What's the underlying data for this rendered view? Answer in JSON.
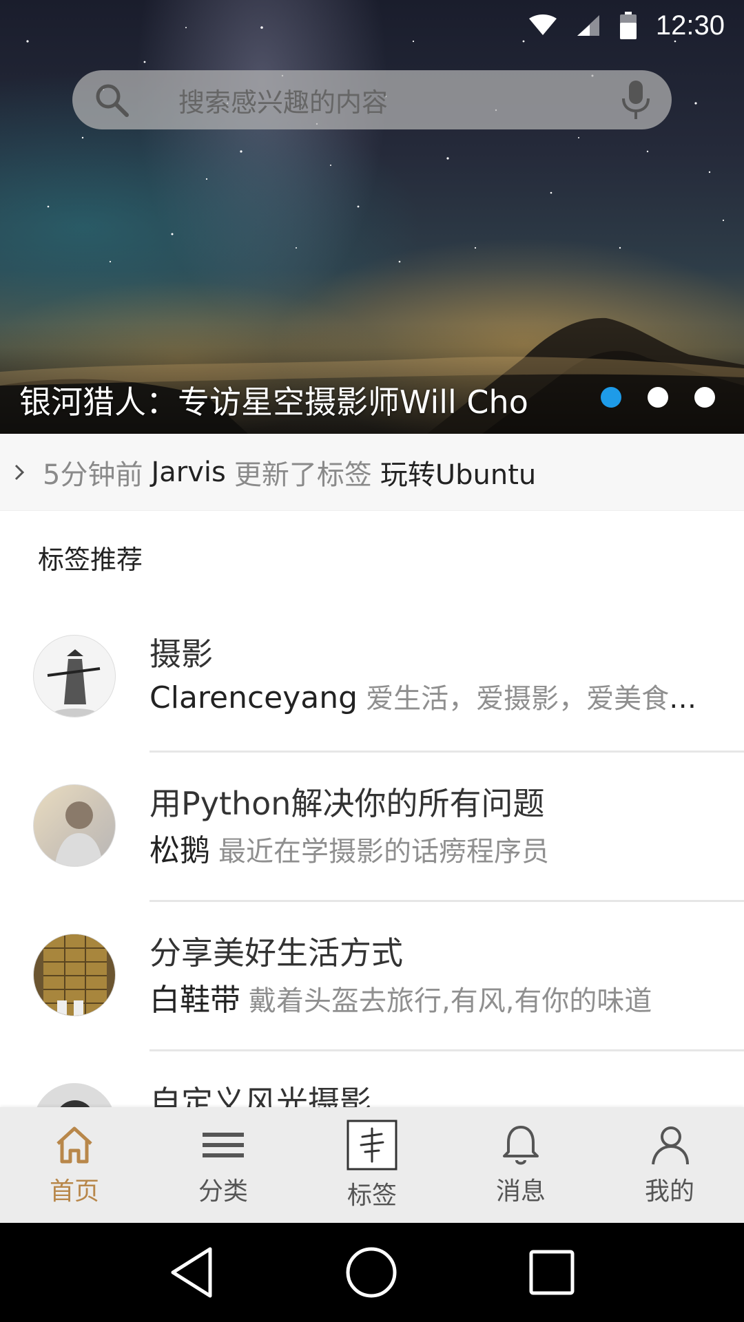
{
  "status": {
    "time": "12:30"
  },
  "search": {
    "placeholder": "搜索感兴趣的内容"
  },
  "banner": {
    "caption": "银河猎人：专访星空摄影师Will Cho",
    "dots": 3,
    "active_dot": 0,
    "accent": "#1e9be8"
  },
  "ticker": {
    "time_ago": "5分钟前",
    "user": "Jarvis",
    "action": "更新了标签",
    "tag": "玩转Ubuntu"
  },
  "section": {
    "title": "标签推荐"
  },
  "tags": [
    {
      "title": "摄影",
      "author": "Clarenceyang",
      "bio": "爱生活，爱摄影，爱美食，爱旅行"
    },
    {
      "title": "用Python解决你的所有问题",
      "author": "松鹅",
      "bio": "最近在学摄影的话痨程序员"
    },
    {
      "title": "分享美好生活方式",
      "author": "白鞋带",
      "bio": "戴着头盔去旅行,有风,有你的味道"
    },
    {
      "title": "自定义风光摄影",
      "author": "",
      "bio": ""
    }
  ],
  "bottom_nav": {
    "items": [
      {
        "label": "首页",
        "icon": "home-icon",
        "active": true
      },
      {
        "label": "分类",
        "icon": "menu-icon",
        "active": false
      },
      {
        "label": "标签",
        "icon": "tag-stamp-icon",
        "active": false
      },
      {
        "label": "消息",
        "icon": "bell-icon",
        "active": false
      },
      {
        "label": "我的",
        "icon": "person-icon",
        "active": false
      }
    ],
    "active_color": "#b8874a"
  }
}
